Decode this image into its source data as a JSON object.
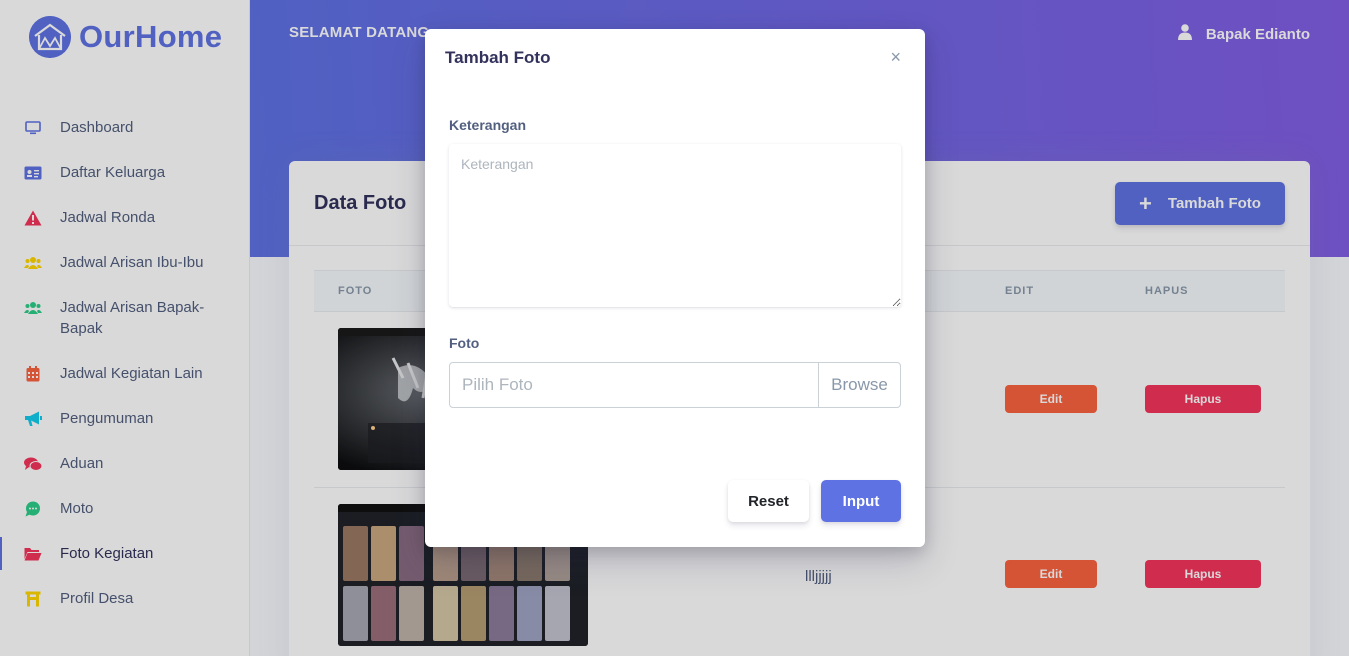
{
  "brand": {
    "name": "OurHome",
    "color": "#5e72e4"
  },
  "sidebar": {
    "items": [
      {
        "label": "Dashboard",
        "icon": "monitor-icon",
        "color": "#5e72e4"
      },
      {
        "label": "Daftar Keluarga",
        "icon": "id-card-icon",
        "color": "#5e72e4"
      },
      {
        "label": "Jadwal Ronda",
        "icon": "warning-icon",
        "color": "#f5365c"
      },
      {
        "label": "Jadwal Arisan Ibu-Ibu",
        "icon": "users-icon",
        "color": "#ffd600"
      },
      {
        "label": "Jadwal Arisan Bapak-Bapak",
        "icon": "users-icon",
        "color": "#2dce89"
      },
      {
        "label": "Jadwal Kegiatan Lain",
        "icon": "calendar-icon",
        "color": "#fb6340"
      },
      {
        "label": "Pengumuman",
        "icon": "megaphone-icon",
        "color": "#11cdef"
      },
      {
        "label": "Aduan",
        "icon": "comments-icon",
        "color": "#f5365c"
      },
      {
        "label": "Moto",
        "icon": "chat-bubble-icon",
        "color": "#2dce89"
      },
      {
        "label": "Foto Kegiatan",
        "icon": "folder-open-icon",
        "color": "#f5365c",
        "active": true
      },
      {
        "label": "Profil Desa",
        "icon": "building-icon",
        "color": "#ffd600"
      }
    ]
  },
  "header": {
    "welcome": "SELAMAT DATANG",
    "user_name": "Bapak Edianto"
  },
  "card": {
    "title": "Data Foto",
    "add_button": "Tambah Foto",
    "columns": [
      "FOTO",
      "EDIT",
      "HAPUS"
    ],
    "rows": [
      {
        "keterangan": "",
        "edit": "Edit",
        "hapus": "Hapus"
      },
      {
        "keterangan": "llljjjjj",
        "edit": "Edit",
        "hapus": "Hapus"
      }
    ]
  },
  "modal": {
    "title": "Tambah Foto",
    "close": "×",
    "keterangan_label": "Keterangan",
    "keterangan_placeholder": "Keterangan",
    "foto_label": "Foto",
    "foto_placeholder": "Pilih Foto",
    "browse": "Browse",
    "reset": "Reset",
    "input": "Input"
  },
  "colors": {
    "primary": "#5e72e4",
    "warning": "#fb6340",
    "danger": "#f5365c"
  }
}
